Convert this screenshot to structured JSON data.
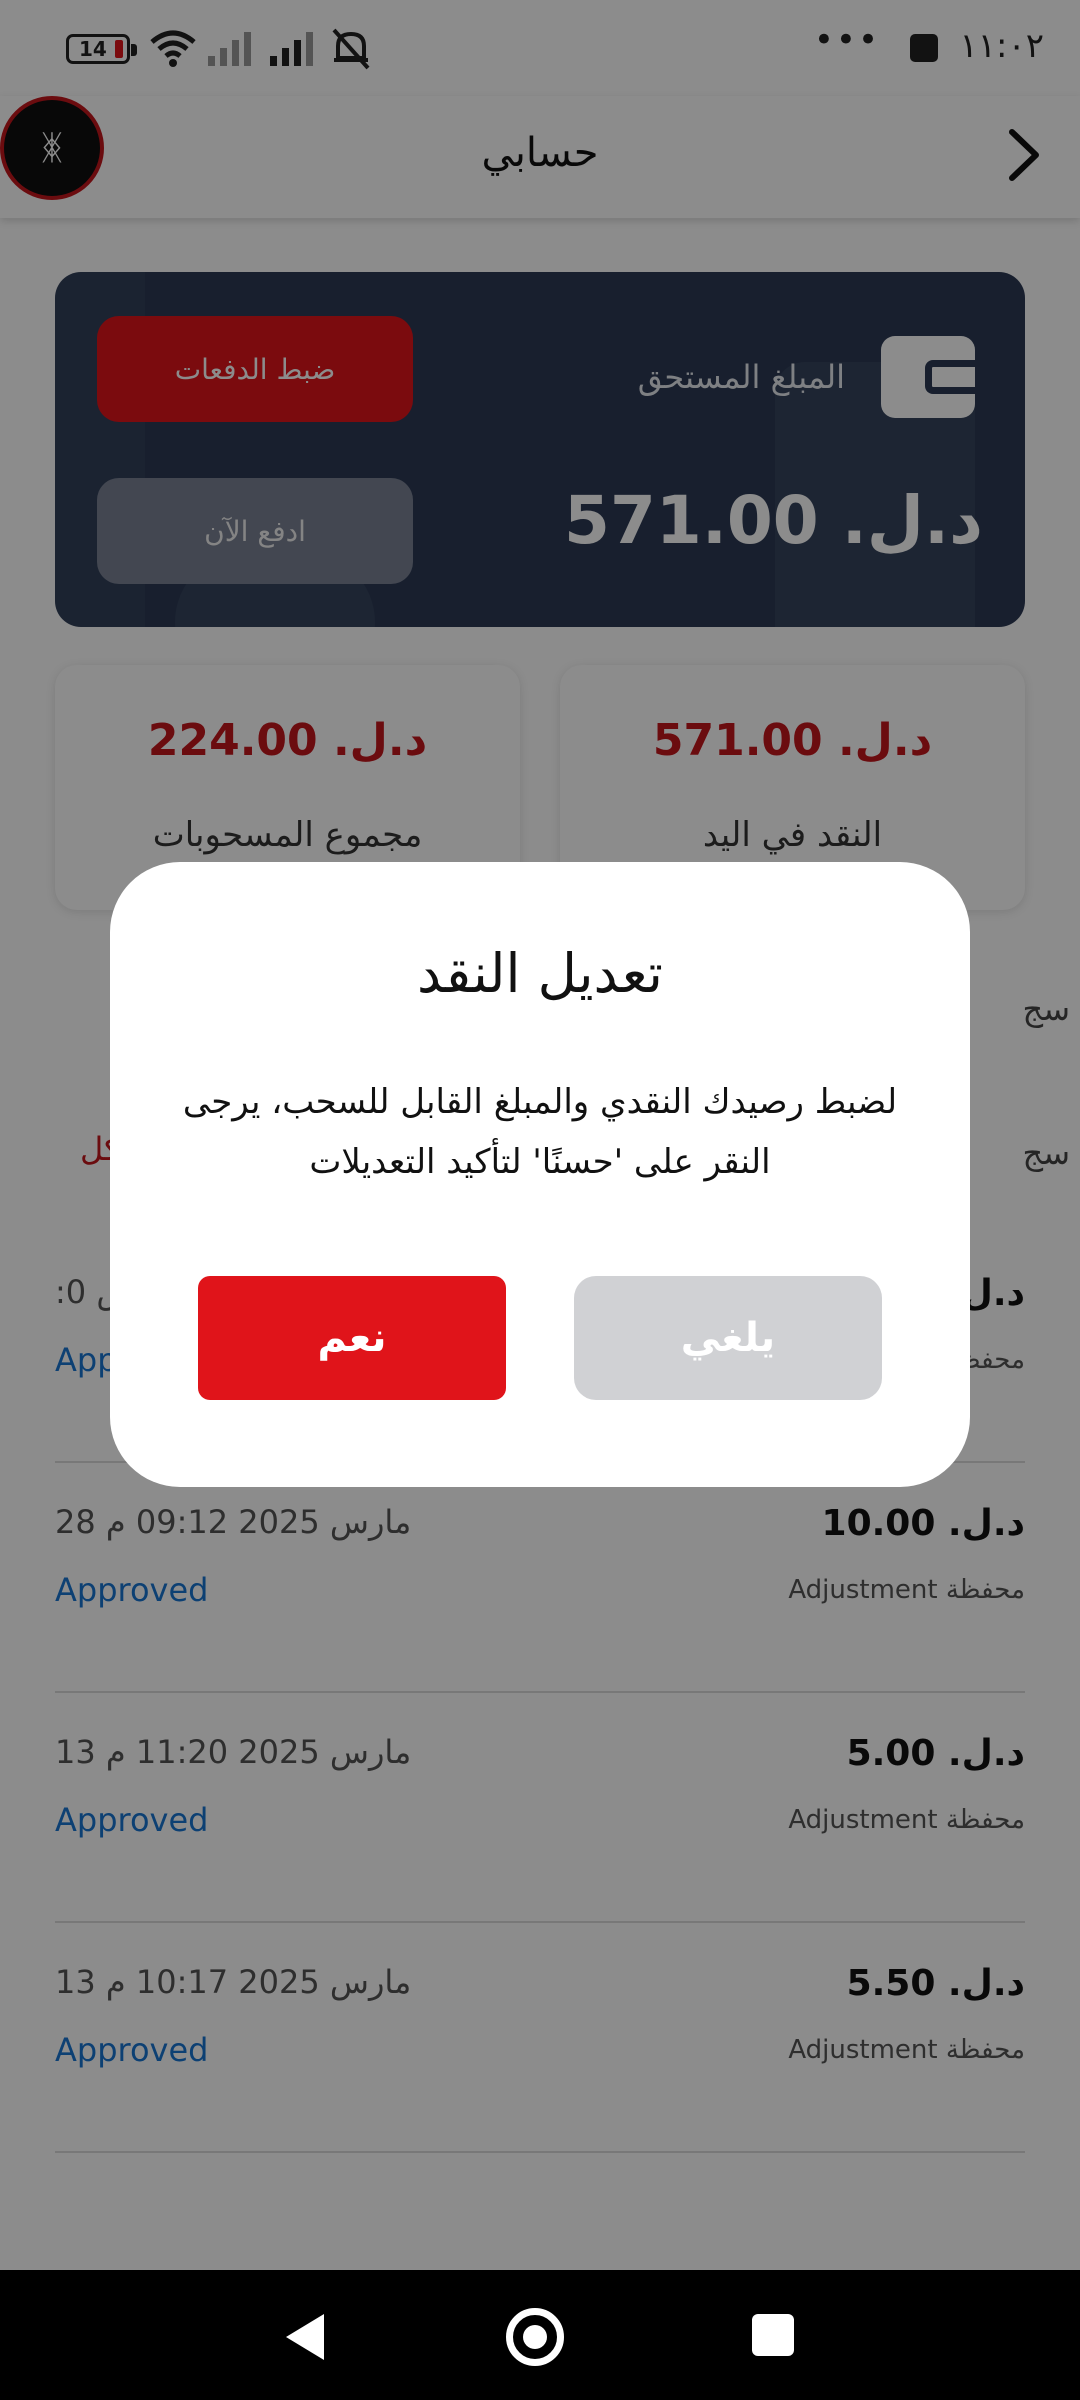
{
  "status_bar": {
    "time": "١١:٠٢",
    "battery": "14",
    "dots": "•••"
  },
  "app_bar": {
    "title": "حسابي",
    "avatar_symbol": "ᛤ"
  },
  "balance_card": {
    "due_label": "المبلغ المستحق",
    "due_amount": "د.ل. 571.00",
    "adjust_button": "ضبط الدفعات",
    "pay_now_button": "ادفع الآن"
  },
  "stats": [
    {
      "amount": "د.ل. 571.00",
      "label": "النقد في اليد"
    },
    {
      "amount": "د.ل. 224.00",
      "label": "مجموع المسحوبات"
    }
  ],
  "sections": {
    "label1": "سج",
    "label2": "سج",
    "red_link_fragment": "كل"
  },
  "transactions": [
    {
      "amount": "د.ل",
      "date": ":0 ص",
      "status": "App",
      "type": "محفظة"
    },
    {
      "amount": "د.ل. 10.00",
      "date": "28 مارس 2025 09:12 م",
      "status": "Approved",
      "type": "Adjustment محفظة"
    },
    {
      "amount": "د.ل. 5.00",
      "date": "13 مارس 2025 11:20 م",
      "status": "Approved",
      "type": "Adjustment محفظة"
    },
    {
      "amount": "د.ل. 5.50",
      "date": "13 مارس 2025 10:17 م",
      "status": "Approved",
      "type": "Adjustment محفظة"
    }
  ],
  "dialog": {
    "title": "تعديل النقد",
    "message": "لضبط رصيدك النقدي والمبلغ القابل للسحب، يرجى النقر على 'حسنًا' لتأكيد التعديلات",
    "confirm_button": "نعم",
    "cancel_button": "يلغي"
  },
  "colors": {
    "brand_red": "#e0141a",
    "card_navy": "#2c3a55",
    "approved_blue": "#1976d2"
  }
}
